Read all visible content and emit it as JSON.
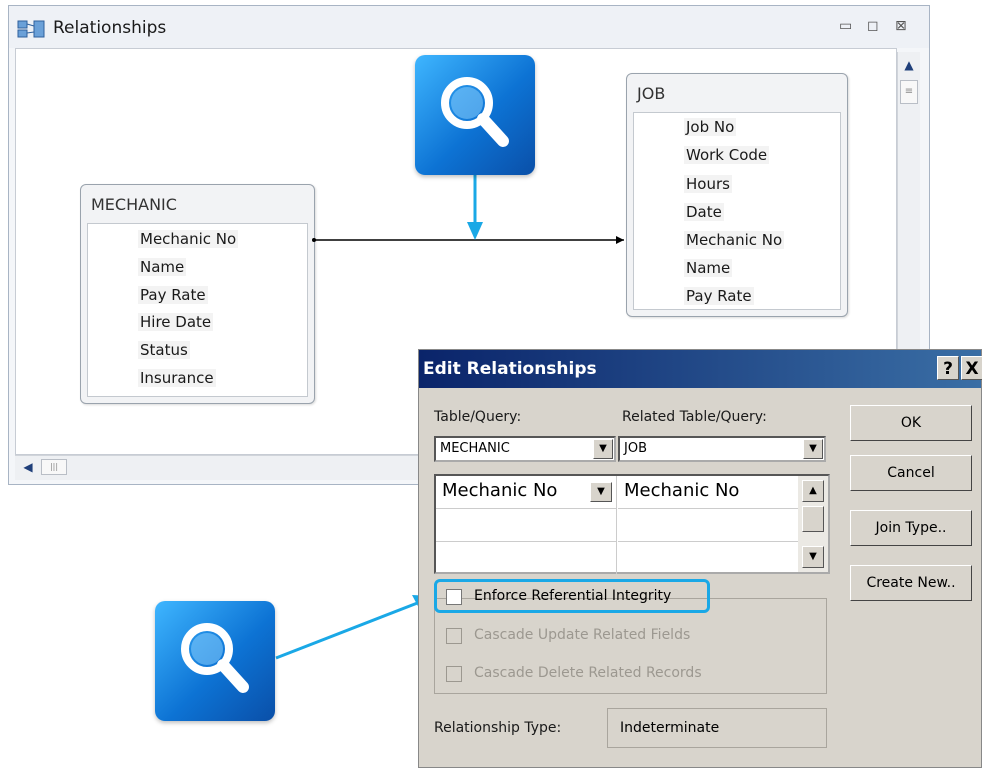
{
  "relationships_window": {
    "title": "Relationships",
    "controls": {
      "minimize": "▭",
      "restore": "◻",
      "close": "⊠"
    }
  },
  "tables": {
    "mechanic": {
      "name": "MECHANIC",
      "fields": [
        "Mechanic No",
        "Name",
        "Pay Rate",
        "Hire Date",
        "Status",
        "Insurance"
      ]
    },
    "job": {
      "name": "JOB",
      "fields": [
        "Job No",
        "Work Code",
        "Hours",
        "Date",
        "Mechanic No",
        "Name",
        "Pay Rate"
      ]
    }
  },
  "edit_dialog": {
    "title": "Edit Relationships",
    "help_button": "?",
    "close_button": "X",
    "table_query_label": "Table/Query:",
    "related_table_query_label": "Related Table/Query:",
    "table_query_value": "MECHANIC",
    "related_table_query_value": "JOB",
    "join_left_field": "Mechanic No",
    "join_right_field": "Mechanic No",
    "buttons": {
      "ok": "OK",
      "cancel": "Cancel",
      "join_type": "Join Type..",
      "create_new": "Create New.."
    },
    "enforce_integrity_label": "Enforce Referential Integrity",
    "cascade_update_label": "Cascade Update Related Fields",
    "cascade_delete_label": "Cascade Delete Related Records",
    "relationship_type_label": "Relationship Type:",
    "relationship_type_value": "Indeterminate"
  },
  "colors": {
    "accent_highlight": "#1aa8e6",
    "dialog_title_bar": "#0a246a",
    "magnifier_badge": "#1a8fe8"
  },
  "icons": {
    "magnifier": "magnifier-icon",
    "relationships": "relationships-icon"
  }
}
